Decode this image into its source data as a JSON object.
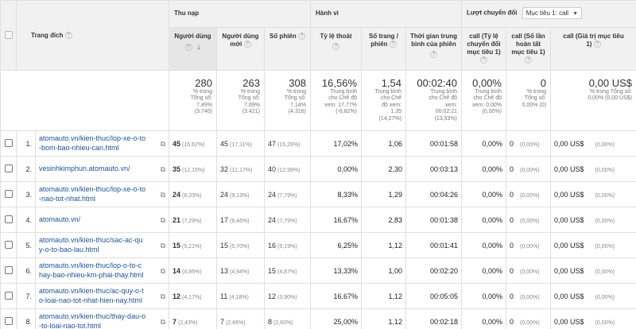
{
  "header": {
    "landing_page": "Trang đích",
    "groups": {
      "acquisition": "Thu nạp",
      "behavior": "Hành vi",
      "conversions": "Lượt chuyển đổi",
      "goal_select": "Mục tiêu 1: call"
    },
    "columns": {
      "users": "Người dùng",
      "new_users_1": "Người dùng",
      "new_users_2": "mới",
      "sessions": "Số phiên",
      "bounce": "Tỷ lệ thoát",
      "pages_1": "Số trang /",
      "pages_2": "phiên",
      "duration_1": "Thời gian trung",
      "duration_2": "bình của phiên",
      "conv_rate_1": "call (Tỷ lệ",
      "conv_rate_2": "chuyển đổi",
      "conv_rate_3": "mục tiêu 1)",
      "completions_1": "call (Số lần",
      "completions_2": "hoàn tất",
      "completions_3": "mục tiêu 1)",
      "value_1": "call (Giá trị mục tiêu",
      "value_2": "1)"
    },
    "help_icon": "?",
    "sort_arrow": "↓"
  },
  "totals": {
    "users": {
      "big": "280",
      "l1": "% trong",
      "l2": "Tổng số:",
      "l3": "7,49%",
      "l4": "(3.740)"
    },
    "new_users": {
      "big": "263",
      "l1": "% trong",
      "l2": "Tổng số:",
      "l3": "7,69%",
      "l4": "(3.421)"
    },
    "sessions": {
      "big": "308",
      "l1": "% trong",
      "l2": "Tổng số:",
      "l3": "7,14%",
      "l4": "(4.316)"
    },
    "bounce": {
      "big": "16,56%",
      "l1": "Trung bình",
      "l2": "cho Chế độ",
      "l3": "xem: 17,77%",
      "l4": "(-6,82%)"
    },
    "pages": {
      "big": "1,54",
      "l1": "Trung bình",
      "l2": "cho Chế",
      "l3": "độ xem:",
      "l4": "1,35",
      "l5": "(14,27%)"
    },
    "duration": {
      "big": "00:02:40",
      "l1": "Trung bình",
      "l2": "cho Chế độ",
      "l3": "xem:",
      "l4": "00:02:21",
      "l5": "(13,53%)"
    },
    "conv_rate": {
      "big": "0,00%",
      "l1": "Trung bình",
      "l2": "cho Chế độ",
      "l3": "xem: 0,00%",
      "l4": "(0,00%)"
    },
    "completions": {
      "big": "0",
      "l1": "% trong",
      "l2": "Tổng số:",
      "l3": "0,00% (0)"
    },
    "value": {
      "big": "0,00 US$",
      "l1": "% trong Tổng số:",
      "l2": "0,00% (0,00 US$)"
    }
  },
  "rows": [
    {
      "idx": "1.",
      "page_1": "atomauto.vn/kien-thuc/lop-xe-o-to",
      "page_2": "-bom-bao-nhieu-can.html",
      "users": "45",
      "users_pct": "(15,62%)",
      "new_users": "45",
      "new_users_pct": "(17,11%)",
      "sessions": "47",
      "sessions_pct": "(15,26%)",
      "bounce": "17,02%",
      "pages": "1,06",
      "duration": "00:01:58",
      "conv_rate": "0,00%",
      "completions": "0",
      "completions_pct": "(0,00%)",
      "value": "0,00 US$",
      "value_pct": "(0,00%)"
    },
    {
      "idx": "2.",
      "page_1": "vesinhkimphun.atomauto.vn/",
      "page_2": "",
      "users": "35",
      "users_pct": "(12,15%)",
      "new_users": "32",
      "new_users_pct": "(12,17%)",
      "sessions": "40",
      "sessions_pct": "(12,99%)",
      "bounce": "0,00%",
      "pages": "2,30",
      "duration": "00:03:13",
      "conv_rate": "0,00%",
      "completions": "0",
      "completions_pct": "(0,00%)",
      "value": "0,00 US$",
      "value_pct": "(0,00%)"
    },
    {
      "idx": "3.",
      "page_1": "atomauto.vn/kien-thuc/lop-xe-o-to",
      "page_2": "-nao-tot-nhat.html",
      "users": "24",
      "users_pct": "(8,33%)",
      "new_users": "24",
      "new_users_pct": "(9,13%)",
      "sessions": "24",
      "sessions_pct": "(7,79%)",
      "bounce": "8,33%",
      "pages": "1,29",
      "duration": "00:04:26",
      "conv_rate": "0,00%",
      "completions": "0",
      "completions_pct": "(0,00%)",
      "value": "0,00 US$",
      "value_pct": "(0,00%)"
    },
    {
      "idx": "4.",
      "page_1": "atomauto.vn/",
      "page_2": "",
      "users": "21",
      "users_pct": "(7,29%)",
      "new_users": "17",
      "new_users_pct": "(6,46%)",
      "sessions": "24",
      "sessions_pct": "(7,79%)",
      "bounce": "16,67%",
      "pages": "2,83",
      "duration": "00:01:38",
      "conv_rate": "0,00%",
      "completions": "0",
      "completions_pct": "(0,00%)",
      "value": "0,00 US$",
      "value_pct": "(0,00%)"
    },
    {
      "idx": "5.",
      "page_1": "atomauto.vn/kien-thuc/sac-ac-qu",
      "page_2": "y-o-to-bao-lau.html",
      "users": "15",
      "users_pct": "(5,21%)",
      "new_users": "15",
      "new_users_pct": "(5,70%)",
      "sessions": "16",
      "sessions_pct": "(5,19%)",
      "bounce": "6,25%",
      "pages": "1,12",
      "duration": "00:01:41",
      "conv_rate": "0,00%",
      "completions": "0",
      "completions_pct": "(0,00%)",
      "value": "0,00 US$",
      "value_pct": "(0,00%)"
    },
    {
      "idx": "6.",
      "page_1": "atomauto.vn/kien-thuc/lop-o-to-c",
      "page_2": "hay-bao-nhieu-km-phai-thay.html",
      "users": "14",
      "users_pct": "(4,86%)",
      "new_users": "13",
      "new_users_pct": "(4,94%)",
      "sessions": "15",
      "sessions_pct": "(4,87%)",
      "bounce": "13,33%",
      "pages": "1,00",
      "duration": "00:02:20",
      "conv_rate": "0,00%",
      "completions": "0",
      "completions_pct": "(0,00%)",
      "value": "0,00 US$",
      "value_pct": "(0,00%)"
    },
    {
      "idx": "7.",
      "page_1": "atomauto.vn/kien-thuc/ac-quy-o-t",
      "page_2": "o-loai-nao-tot-nhat-hien-nay.html",
      "users": "12",
      "users_pct": "(4,17%)",
      "new_users": "11",
      "new_users_pct": "(4,18%)",
      "sessions": "12",
      "sessions_pct": "(3,90%)",
      "bounce": "16,67%",
      "pages": "1,12",
      "duration": "00:05:05",
      "conv_rate": "0,00%",
      "completions": "0",
      "completions_pct": "(0,00%)",
      "value": "0,00 US$",
      "value_pct": "(0,00%)"
    },
    {
      "idx": "8.",
      "page_1": "atomauto.vn/kien-thuc/thay-dau-o",
      "page_2": "-to-loai-nao-tot.html",
      "users": "7",
      "users_pct": "(2,43%)",
      "new_users": "7",
      "new_users_pct": "(2,66%)",
      "sessions": "8",
      "sessions_pct": "(2,60%)",
      "bounce": "25,00%",
      "pages": "1,12",
      "duration": "00:02:18",
      "conv_rate": "0,00%",
      "completions": "0",
      "completions_pct": "(0,00%)",
      "value": "0,00 US$",
      "value_pct": "(0,00%)"
    }
  ],
  "icons": {
    "external_link": "external-link-icon",
    "help": "help-icon",
    "sort": "sort-down-icon",
    "dropdown": "chevron-down-icon"
  }
}
